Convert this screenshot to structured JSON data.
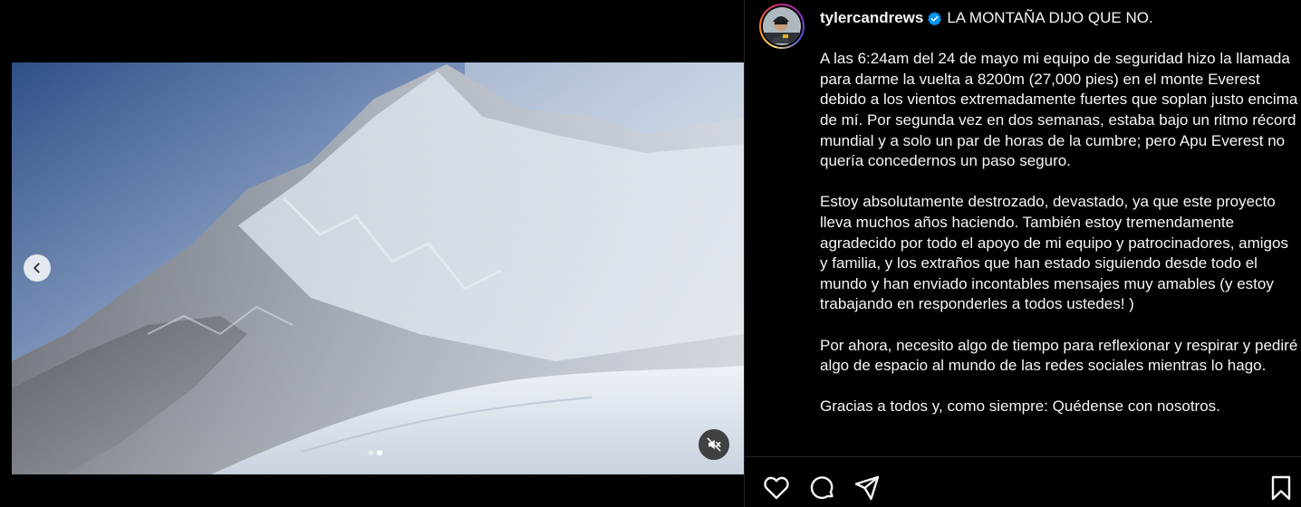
{
  "post": {
    "username": "tylercandrews",
    "title_line": "LA MONTAÑA DIJO QUE NO.",
    "paragraphs": [
      "A las 6:24am del 24 de mayo mi equipo de seguridad hizo la llamada para darme la vuelta a 8200m (27,000 pies) en el monte Everest debido a los vientos extremadamente fuertes que soplan justo encima de mí. Por segunda vez en dos semanas, estaba bajo un ritmo récord mundial y a solo un par de horas de la cumbre; pero Apu Everest no quería concedernos un paso seguro.",
      "Estoy absolutamente destrozado, devastado, ya que este proyecto lleva muchos años haciendo. También estoy tremendamente agradecido por todo el apoyo de mi equipo y patrocinadores, amigos y familia, y los extraños que han estado siguiendo desde todo el mundo y han enviado incontables mensajes muy amables (y estoy trabajando en responderles a todos ustedes! )",
      "Por ahora, necesito algo de tiempo para reflexionar y respirar y pediré algo de espacio al mundo de las redes sociales mientras lo hago.",
      "Gracias a todos y, como siempre: Quédense con nosotros."
    ]
  },
  "media": {
    "carousel_count": 2,
    "active_index": 1,
    "icons": {
      "prev": "chevron-left-icon",
      "mute": "muted-speaker-icon"
    }
  },
  "actions": {
    "icons": [
      "heart-icon",
      "comment-icon",
      "share-icon",
      "bookmark-icon"
    ]
  },
  "colors": {
    "background": "#000000",
    "text": "#f5f5f5",
    "verified": "#0095f6",
    "divider": "#262626"
  }
}
